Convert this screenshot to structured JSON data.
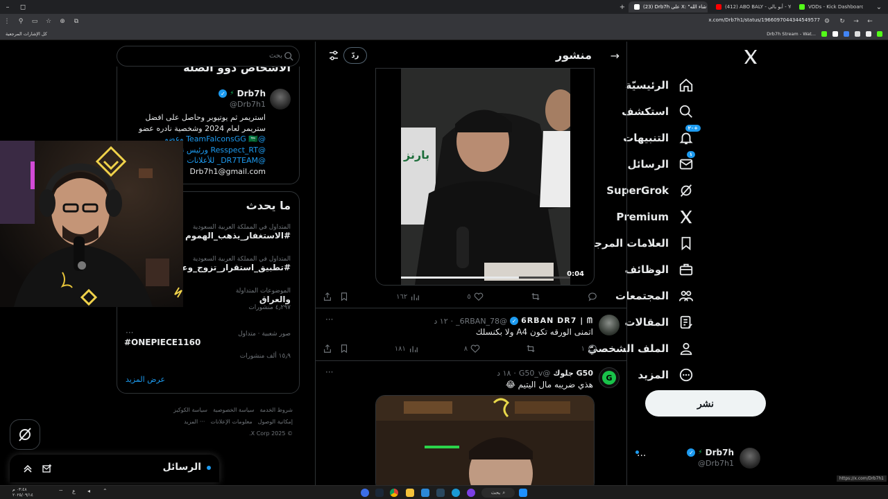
{
  "browser": {
    "tabs": [
      {
        "label": "VODs - Kick Dashboard"
      },
      {
        "label": "(412) ABO BALY - أبو بالي - You"
      },
      {
        "label": "(23) Drb7h على X: \"يا اللي ان شاء الله"
      }
    ],
    "url": "x.com/Drb7h1/status/1966097044344549577",
    "bookmarks_label": "كل الإشارات المرجعية",
    "bookmark_right": "Drb7h Stream - Wat..."
  },
  "nav": {
    "items": [
      {
        "label": "الرئيسيّة",
        "icon": "home-icon"
      },
      {
        "label": "استكشف",
        "icon": "search-icon"
      },
      {
        "label": "التنبيهات",
        "icon": "bell-icon",
        "badge": "+٢٠"
      },
      {
        "label": "الرسائل",
        "icon": "mail-icon",
        "badge": "١"
      },
      {
        "label": "SuperGrok",
        "icon": "grok-icon"
      },
      {
        "label": "Premium",
        "icon": "x-icon"
      },
      {
        "label": "العلامات المرجعية",
        "icon": "bookmark-icon"
      },
      {
        "label": "الوظائف",
        "icon": "briefcase-icon"
      },
      {
        "label": "المجتمعات",
        "icon": "people-icon"
      },
      {
        "label": "المقالات",
        "icon": "article-icon"
      },
      {
        "label": "الملف الشخصيّ",
        "icon": "profile-icon"
      },
      {
        "label": "المزيد",
        "icon": "more-icon"
      }
    ],
    "post_label": "نشر",
    "user": {
      "name": "Drb7h",
      "handle": "@Drb7h1"
    }
  },
  "main": {
    "title": "منشور",
    "reply_label": "ردّ",
    "video": {
      "duration": "0:04",
      "sign_text": "بارنز"
    },
    "first_actions": {
      "views": "١٦٢",
      "likes": "٥"
    },
    "tweets": [
      {
        "name": "6RBAN DR7 | ᗰ",
        "handle": "@6RBAN_78_",
        "time": "١٢ د",
        "text": "اتمنى الورقه تكون A4 ولا بكنسلك",
        "replies": "١",
        "likes": "٨",
        "views": "١٨١"
      },
      {
        "name": "G50 جلوك",
        "handle": "@G50_v",
        "time": "١٨ د",
        "text": "هذي ضريبه مال اليتيم 😂"
      }
    ]
  },
  "sidebar": {
    "search_placeholder": "بحث",
    "people": {
      "heading": "الأشخاص ذوو الصلة",
      "name": "Drb7h",
      "handle": "@Drb7h1",
      "bio_lines": [
        "استريمر ثم يوتيوبر وحاصل على افضل",
        "ستريمر لعام 2024 وشخصية نادره عضو",
        "@TeamFalconsGG 🇸🇦 وعضو",
        "@Resspect_RT ورئيس نادي",
        "@DR7TEAM_ للأعلانات",
        "Drb7h1@gmail.com"
      ]
    },
    "trends": {
      "heading": "ما يحدث",
      "items": [
        {
          "meta": "المتداول في المملكة العربية السعودية",
          "tag": "#الاستغفار_يذهب_الهموم"
        },
        {
          "meta": "المتداول في المملكة العربية السعودية",
          "tag": "#تطبيق_استقرار_تزوج_وعش"
        },
        {
          "meta": "الموضوعات المتداولة",
          "tag": "والعراق",
          "count": "٤٫٢٩٧ منشورات"
        },
        {
          "meta": "صور شعبية · متداول",
          "tag": "#ONEPIECE1160",
          "count": "١٥٫٩ ألف منشورات"
        }
      ],
      "show_more": "عرض المزيد"
    },
    "footer": [
      "شروط الخدمة",
      "سياسة الخصوصية",
      "سياسة الكوكيز",
      "إمكانية الوصول",
      "معلومات الإعلانات",
      "··· المزيد",
      "© 2025 X Corp."
    ]
  },
  "messages_dock": {
    "title": "الرسائل"
  },
  "taskbar": {
    "search_label": "بحث",
    "time": "٠٣:٤٨ م",
    "date": "٢٠٢٥/٠٩/١٤"
  },
  "status_url": "https://x.com/Drb7h1"
}
